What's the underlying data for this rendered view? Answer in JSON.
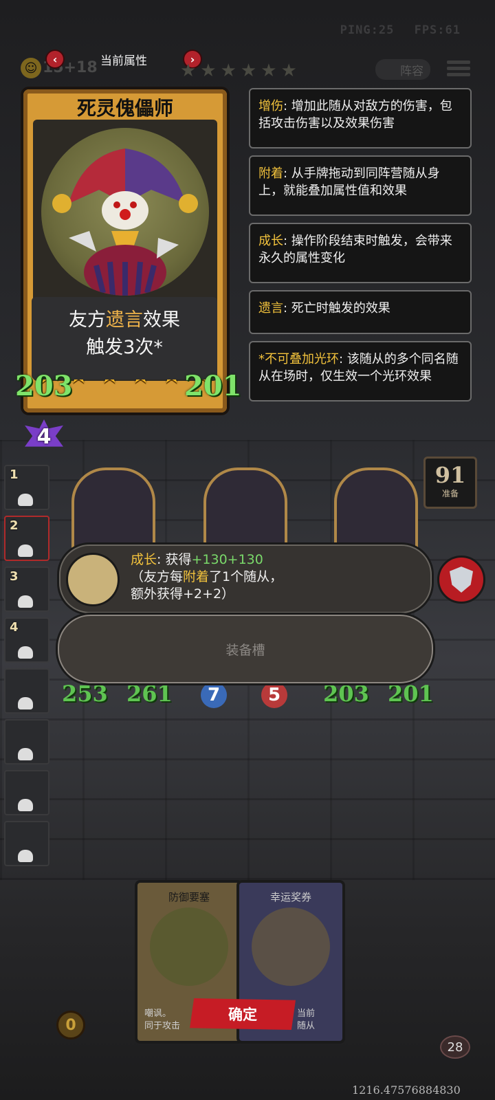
{
  "hud": {
    "ping": "PING:25",
    "fps": "FPS:61"
  },
  "header": {
    "title": "当前属性",
    "prev_icon": "chevron-left-icon",
    "next_icon": "chevron-right-icon",
    "gold": "15+18",
    "lineup_label": "阵容"
  },
  "hero_card": {
    "name": "死灵傀儡师",
    "stars": 6,
    "desc_pre": "友方",
    "desc_keyword": "遗言",
    "desc_post": "效果",
    "desc_line2": "触发3次*",
    "attack": "203",
    "health": "201",
    "cost": "4"
  },
  "keywords": [
    {
      "key": "增伤",
      "text": ": 增加此随从对敌方的伤害，包括攻击伤害以及效果伤害"
    },
    {
      "key": "附着",
      "text": ": 从手牌拖动到同阵营随从身上，就能叠加属性值和效果"
    },
    {
      "key": "成长",
      "text": ": 操作阶段结束时触发，会带来永久的属性变化"
    },
    {
      "key": "遗言",
      "text": ": 死亡时触发的效果"
    },
    {
      "key": "*不可叠加光环",
      "text": ": 该随从的多个同名随从在场时，仅生效一个光环效果"
    }
  ],
  "bench_slots": [
    "1",
    "2",
    "3",
    "4",
    "",
    "",
    "",
    ""
  ],
  "ready": {
    "value": "91",
    "label": "准备"
  },
  "board_stats": {
    "u1_atk": "253",
    "u1_hp": "261",
    "u2_atk": "7",
    "u2_hp": "5",
    "u3_atk": "203",
    "u3_hp": "201"
  },
  "growth": {
    "key": "成长",
    "label": ": 获得",
    "plus1": "+130",
    "plus2": "+130",
    "line2_pre": "（友方每",
    "line2_key": "附着",
    "line2_post": "了1个随从，",
    "line3_pre": "额外获得",
    "line3_val": "+2+2",
    "line3_post": "）"
  },
  "equip_slot_label": "装备槽",
  "bottom_cards": [
    {
      "title": "防御要塞",
      "desc1": "嘲讽。",
      "desc2": "同于攻击"
    },
    {
      "title": "幸运奖券",
      "desc1": "当前",
      "desc2": "随从"
    }
  ],
  "confirm_label": "确定",
  "coins": "0",
  "hero_level": "28",
  "coord_text": "1216.47576884830",
  "colors": {
    "accent_red": "#c61c25",
    "keyword_gold": "#f2c23c",
    "stat_green": "#7fe36a"
  }
}
